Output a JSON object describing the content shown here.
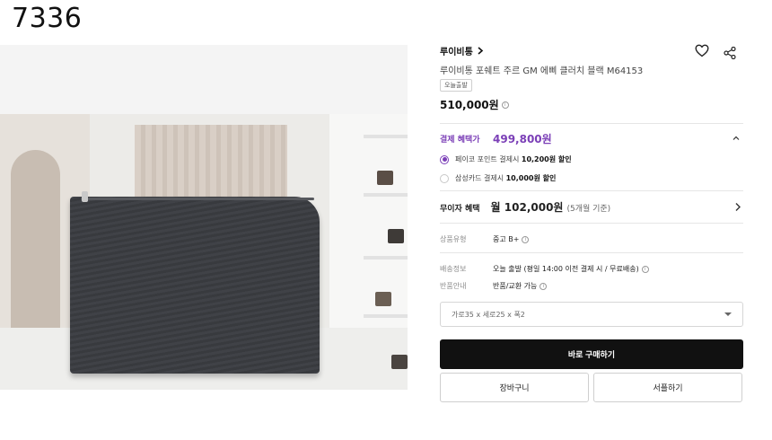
{
  "overlay_code": "7336",
  "product": {
    "brand": "루이비통",
    "brand_chevron_icon": "chevron-right-icon",
    "title": "루이비통 포쉐트 주르 GM 에삐 클러치 블랙 M64153",
    "badge": "오늘출발",
    "price": "510,000원",
    "image_alt": "black epi leather clutch bag"
  },
  "actions": {
    "wishlist_icon": "heart-icon",
    "share_icon": "share-icon"
  },
  "benefit": {
    "label": "결제 혜택가",
    "price": "499,800원",
    "options": [
      {
        "prefix": "페이코 포인트 결제시",
        "amount": "10,200원 할인",
        "selected": true
      },
      {
        "prefix": "삼성카드 결제시",
        "amount": "10,000원 할인",
        "selected": false
      }
    ]
  },
  "installment": {
    "label": "무이자 혜택",
    "amount": "월 102,000원",
    "period": "(5개월 기준)"
  },
  "details": {
    "grade_key": "상품유형",
    "grade_value": "중고 B+",
    "shipping_key": "배송정보",
    "shipping_value": "오늘 출발 (평일 14:00 이전 결제 시 / 무료배송)",
    "return_key": "반품안내",
    "return_value": "반품/교환 가능"
  },
  "size_select": {
    "value": "가로35 x 세로25 x 폭2"
  },
  "buttons": {
    "buy_now": "바로 구매하기",
    "cart": "장바구니",
    "gift": "서플하기"
  },
  "colors": {
    "accent": "#7b3fb7",
    "buy_bg": "#111111"
  }
}
